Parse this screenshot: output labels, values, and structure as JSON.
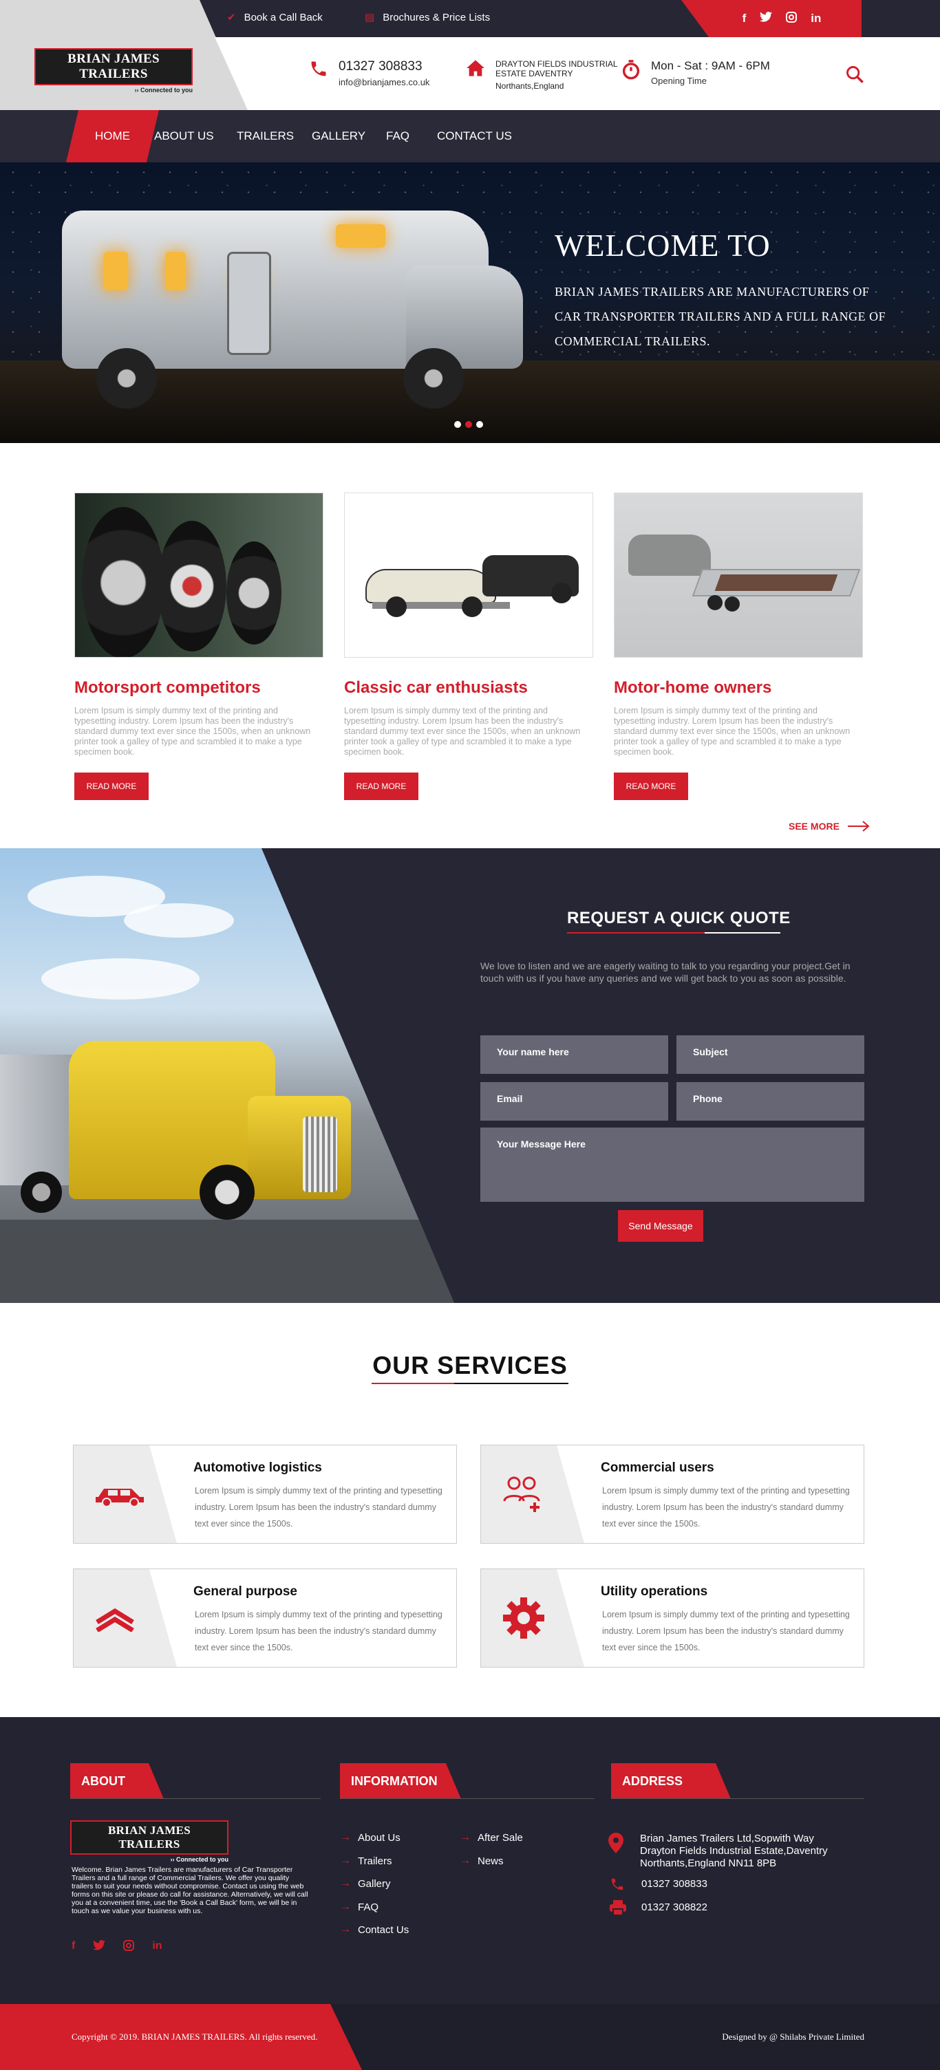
{
  "topbar": {
    "call_back": "Book a Call Back",
    "brochures": "Brochures & Price Lists",
    "social": [
      "f",
      "🐦",
      "◎",
      "in"
    ]
  },
  "brand": {
    "name": "BRIAN JAMES TRAILERS",
    "tagline": "Connected to you"
  },
  "header": {
    "phone": "01327 308833",
    "email": "info@brianjames.co.uk",
    "address_line1": "DRAYTON FIELDS INDUSTRIAL",
    "address_line2": "ESTATE DAVENTRY",
    "address_line3": "Northants,England",
    "hours": "Mon - Sat : 9AM - 6PM",
    "hours_label": "Opening Time"
  },
  "nav": [
    "HOME",
    "ABOUT US",
    "TRAILERS",
    "GALLERY",
    "FAQ",
    "CONTACT US"
  ],
  "hero": {
    "title": "WELCOME TO",
    "text": "BRIAN JAMES TRAILERS ARE MANUFACTURERS OF CAR TRANSPORTER TRAILERS AND A FULL RANGE OF COMMERCIAL TRAILERS."
  },
  "cards": [
    {
      "title": "Motorsport competitors",
      "text": "Lorem Ipsum is simply dummy text of the printing and typesetting industry. Lorem Ipsum has been the industry's standard dummy text ever since the 1500s, when an unknown printer took a galley of type and scrambled it to make a type specimen book.",
      "button": "READ MORE"
    },
    {
      "title": "Classic car enthusiasts",
      "text": "Lorem Ipsum is simply dummy text of the printing and typesetting industry. Lorem Ipsum has been the industry's standard dummy text ever since the 1500s, when an unknown printer took a galley of type and scrambled it to make a type specimen book.",
      "button": "READ MORE"
    },
    {
      "title": "Motor-home owners",
      "text": "Lorem Ipsum is simply dummy text of the printing and typesetting industry. Lorem Ipsum has been the industry's standard dummy text ever since the 1500s, when an unknown printer took a galley of type and scrambled it to make a type specimen book.",
      "button": "READ MORE"
    }
  ],
  "see_more": "SEE MORE",
  "quote": {
    "title": "REQUEST A QUICK QUOTE",
    "text": "We love to listen and we are eagerly waiting to talk to you regarding your project.Get in touch with us if you have any queries and we will get back to you as soon as possible.",
    "name_placeholder": "Your name here",
    "subject_placeholder": "Subject",
    "email_placeholder": "Email",
    "phone_placeholder": "Phone",
    "message_placeholder": "Your Message Here",
    "send": "Send Message"
  },
  "services": {
    "title": "OUR SERVICES",
    "items": [
      {
        "title": "Automotive logistics",
        "text": "Lorem Ipsum is simply dummy text of the printing and typesetting industry. Lorem Ipsum has been the industry's standard dummy text ever since the 1500s.",
        "icon": "car-icon"
      },
      {
        "title": "Commercial users",
        "text": "Lorem Ipsum is simply dummy text of the printing and typesetting industry. Lorem Ipsum has been the industry's standard dummy text ever since the 1500s.",
        "icon": "users-add-icon"
      },
      {
        "title": "General purpose",
        "text": "Lorem Ipsum is simply dummy text of the printing and typesetting industry. Lorem Ipsum has been the industry's standard dummy text ever since the 1500s.",
        "icon": "chevron-up-icon"
      },
      {
        "title": "Utility operations",
        "text": "Lorem Ipsum is simply dummy text of the printing and typesetting industry. Lorem Ipsum has been the industry's standard dummy text ever since the 1500s.",
        "icon": "gear-icon"
      }
    ]
  },
  "footer": {
    "about_head": "ABOUT",
    "about_text": "Welcome. Brian James Trailers are manufacturers of Car Transporter Trailers and a full range of Commercial Trailers. We offer you quality trailers to suit your needs without compromise. Contact us using the web forms on this site or please do call for assistance. Alternatively, we will call you at a convenient time, use the 'Book a Call Back' form, we will be in touch as we value your business with us.",
    "info_head": "INFORMATION",
    "links_col1": [
      "About Us",
      "Trailers",
      "Gallery",
      "FAQ",
      "Contact Us"
    ],
    "links_col2": [
      "After Sale",
      "News"
    ],
    "address_head": "ADDRESS",
    "address": "Brian James Trailers Ltd,Sopwith Way Drayton Fields Industrial Estate,Daventry Northants,England NN11 8PB",
    "phone1": "01327 308833",
    "phone2": "01327 308822",
    "copyright": "Copyright © 2019. BRIAN JAMES TRAILERS. All rights reserved.",
    "designed_by": "Designed by @ Shilabs Private Limited"
  },
  "colors": {
    "accent": "#d21f2b",
    "dark": "#262634"
  }
}
